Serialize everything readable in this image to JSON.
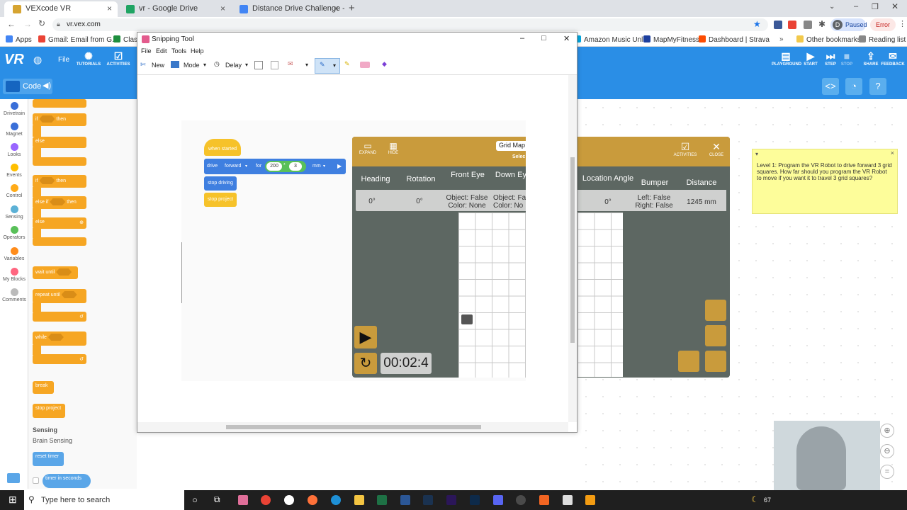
{
  "browser": {
    "tabs": [
      {
        "label": "VEXcode VR",
        "active": true,
        "color": "#1a1a1a"
      },
      {
        "label": "vr - Google Drive",
        "active": false,
        "color": "#1fa463"
      },
      {
        "label": "Distance Drive Challenge - VEXco",
        "active": false,
        "color": "#4285f4"
      }
    ],
    "new_tab": "+",
    "url": "vr.vex.com",
    "paused_label": "Paused",
    "error_label": "Error",
    "profile_initial": "D",
    "bookmarks": [
      {
        "label": "Apps",
        "color": "#4285f4"
      },
      {
        "label": "Gmail: Email from G...",
        "color": "#ea4335"
      },
      {
        "label": "Classr",
        "color": "#1e8e3e"
      },
      {
        "label": "Amazon Music Unli...",
        "color": "#00a8e1"
      },
      {
        "label": "MapMyFitness",
        "color": "#1d3f9e"
      },
      {
        "label": "Dashboard | Strava",
        "color": "#fc4c02"
      },
      {
        "label": "Other bookmarks",
        "color": "#f2c94c"
      },
      {
        "label": "Reading list",
        "color": "#888888"
      }
    ]
  },
  "vex": {
    "logo": "VR",
    "file": "File",
    "tutorials": "TUTORIALS",
    "activities": "ACTIVITIES",
    "right_buttons": [
      "PLAYGROUND",
      "START",
      "STEP",
      "STOP",
      "SHARE",
      "FEEDBACK"
    ],
    "code_label": "Code",
    "accent": "#2a8ee6"
  },
  "categories": [
    {
      "label": "Drivetrain",
      "color": "#3a6fd8"
    },
    {
      "label": "Magnet",
      "color": "#3a6fd8"
    },
    {
      "label": "Looks",
      "color": "#9966ff"
    },
    {
      "label": "Events",
      "color": "#ffbf00"
    },
    {
      "label": "Control",
      "color": "#ffab19"
    },
    {
      "label": "Sensing",
      "color": "#5cb1d6"
    },
    {
      "label": "Operators",
      "color": "#59c059"
    },
    {
      "label": "Variables",
      "color": "#ff8c1a"
    },
    {
      "label": "My Blocks",
      "color": "#ff6680"
    },
    {
      "label": "Comments",
      "color": "#bbbbbb"
    }
  ],
  "palette": {
    "if_then": [
      "if",
      "then"
    ],
    "else": "else",
    "else_if": "else if",
    "wait_until": "wait until",
    "repeat_until": "repeat until",
    "while": "while",
    "break": "break",
    "stop_project": "stop project",
    "sensing_title": "Sensing",
    "brain_sensing": "Brain Sensing",
    "reset_timer": "reset timer",
    "timer_in_seconds": "timer in seconds"
  },
  "snip": {
    "title": "Snipping Tool",
    "menu": [
      "File",
      "Edit",
      "Tools",
      "Help"
    ],
    "new": "New",
    "mode": "Mode",
    "delay": "Delay"
  },
  "program": {
    "when_started": "when started",
    "drive": "drive",
    "direction": "forward",
    "for": "for",
    "value_a": "200",
    "op": "*",
    "value_b": "3",
    "units": "mm",
    "stop_driving": "stop driving",
    "stop_project": "stop project"
  },
  "vr": {
    "expand": "EXPAND",
    "hide": "HIDE",
    "grid_map": "Grid Map",
    "select": "Selec",
    "activities": "ACTIVITIES",
    "close": "CLOSE",
    "headers": [
      "Heading",
      "Rotation",
      "Front Eye",
      "Down Eye",
      "Location Angle",
      "Bumper",
      "Distance"
    ],
    "values": {
      "heading": "0°",
      "rotation": "0°",
      "front_eye": [
        "Object: False",
        "Color: None"
      ],
      "down_eye": [
        "Object: Fa",
        "Color: No"
      ],
      "location_angle": "0°",
      "bumper": [
        "Left: False",
        "Right: False"
      ],
      "distance": "1245 mm"
    },
    "timer": "00:02:4"
  },
  "note": {
    "text": "Level 1: Program the VR Robot to drive forward 3 grid squares. How far should you program the VR Robot to move if you want it to travel 3 grid squares?"
  },
  "taskbar": {
    "search_placeholder": "Type here to search",
    "battery": "67"
  }
}
